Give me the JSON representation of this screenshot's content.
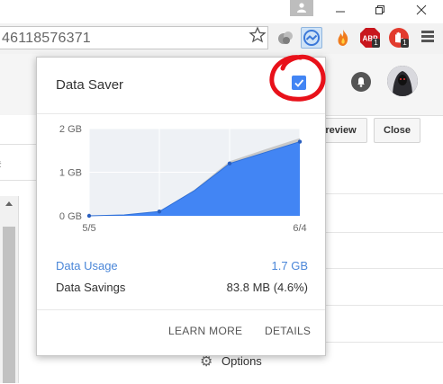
{
  "browser": {
    "omnibox_text": "46118576371",
    "extension_badges": [
      "1",
      "1"
    ]
  },
  "page": {
    "preview_button": "review",
    "close_button": "Close",
    "options_label": "Options",
    "left_fragment": "#"
  },
  "popup": {
    "title": "Data Saver",
    "enabled": true,
    "usage_label": "Data Usage",
    "usage_value": "1.7 GB",
    "savings_label": "Data Savings",
    "savings_value": "83.8 MB (4.6%)",
    "learn_more": "LEARN MORE",
    "details": "DETAILS",
    "accent_color": "#4285f4",
    "usage_color": "#4a86d8"
  },
  "chart_data": {
    "type": "area",
    "x_tick_labels": [
      "5/5",
      "6/4"
    ],
    "y_tick_labels": [
      "2 GB",
      "1 GB",
      "0 GB"
    ],
    "ylim": [
      0,
      2
    ],
    "grid": true,
    "series": [
      {
        "values": [
          0,
          0.02,
          0.1,
          0.58,
          1.2,
          1.45,
          1.7
        ]
      },
      {
        "values": [
          0,
          0.02,
          0.1,
          0.6,
          1.25,
          1.52,
          1.78
        ]
      }
    ]
  }
}
